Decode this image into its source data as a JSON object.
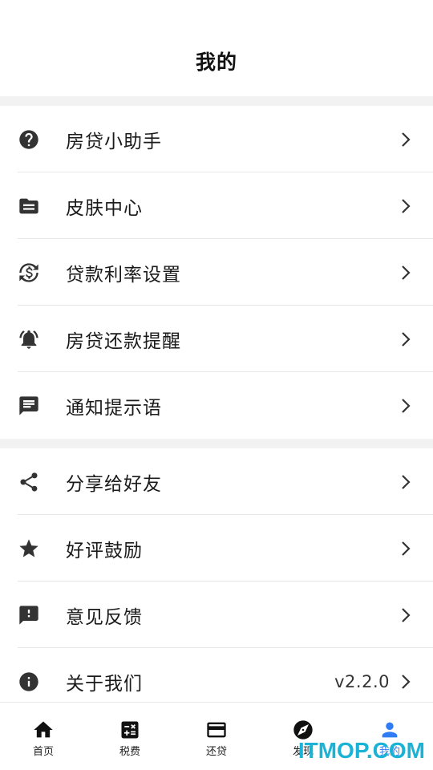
{
  "header": {
    "title": "我的"
  },
  "group1": [
    {
      "label": "房贷小助手",
      "icon": "help-circle-icon"
    },
    {
      "label": "皮肤中心",
      "icon": "folder-icon"
    },
    {
      "label": "贷款利率设置",
      "icon": "currency-refresh-icon"
    },
    {
      "label": "房贷还款提醒",
      "icon": "alarm-bell-icon"
    },
    {
      "label": "通知提示语",
      "icon": "message-icon"
    }
  ],
  "group2": [
    {
      "label": "分享给好友",
      "icon": "share-icon"
    },
    {
      "label": "好评鼓励",
      "icon": "star-icon"
    },
    {
      "label": "意见反馈",
      "icon": "feedback-icon"
    },
    {
      "label": "关于我们",
      "icon": "info-icon",
      "value": "v2.2.0"
    }
  ],
  "tabs": [
    {
      "label": "首页",
      "icon": "home-icon"
    },
    {
      "label": "税费",
      "icon": "calculator-icon"
    },
    {
      "label": "还贷",
      "icon": "credit-card-icon"
    },
    {
      "label": "发现",
      "icon": "compass-icon"
    },
    {
      "label": "我的",
      "icon": "person-icon",
      "active": true
    }
  ],
  "watermark": "ITMOP.COM",
  "colors": {
    "accent": "#2f7cf6",
    "divider": "#e6e6e6",
    "section_gap": "#f2f2f2",
    "watermark": "#1ab3d6"
  }
}
